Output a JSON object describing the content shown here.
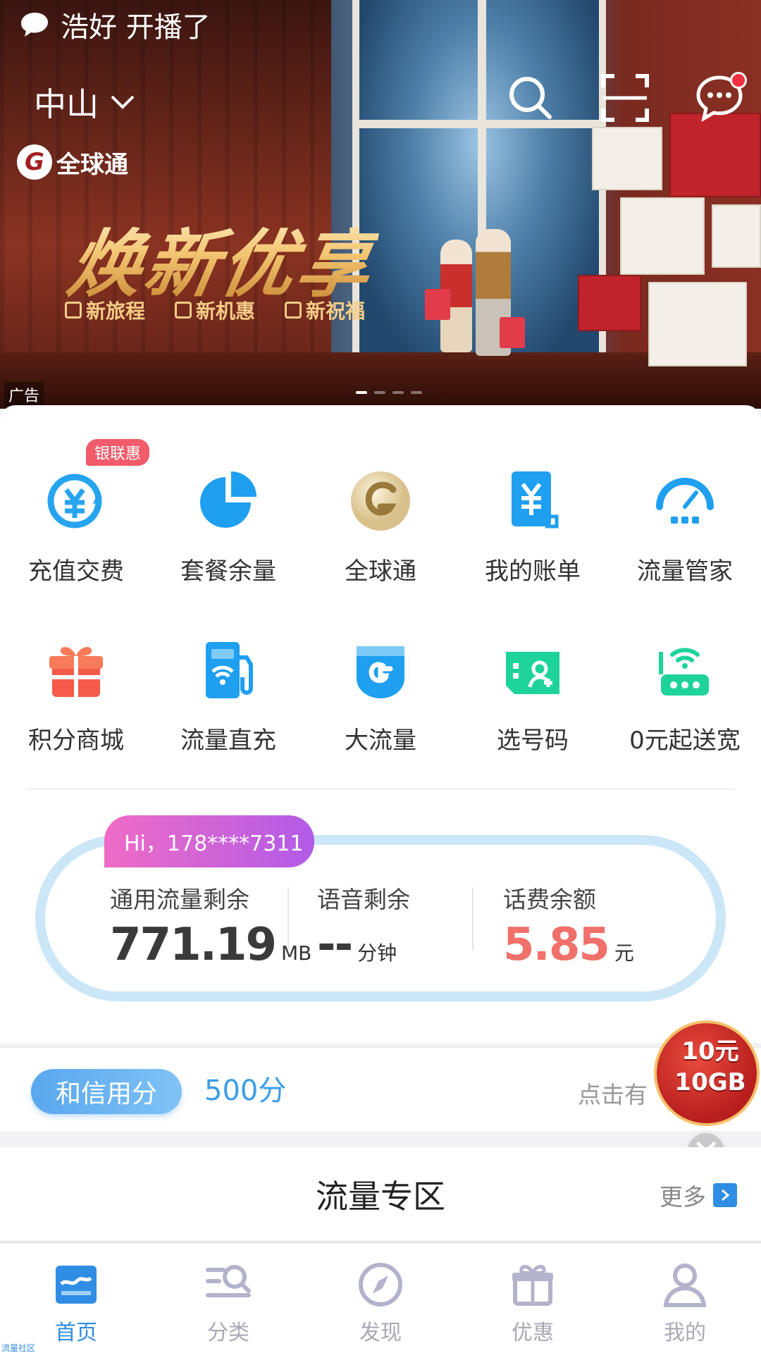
{
  "notification": {
    "text": "浩好 开播了"
  },
  "header": {
    "city": "中山"
  },
  "banner": {
    "brand": "全球通",
    "title": "焕新优享",
    "tags": [
      "新旅程",
      "新机惠",
      "新祝福"
    ],
    "ad_label": "广告"
  },
  "services": [
    {
      "label": "充值交费",
      "icon": "recharge-icon",
      "badge": "银联惠"
    },
    {
      "label": "套餐余量",
      "icon": "pie-chart-icon"
    },
    {
      "label": "全球通",
      "icon": "global-pass-icon"
    },
    {
      "label": "我的账单",
      "icon": "bill-icon"
    },
    {
      "label": "流量管家",
      "icon": "speedometer-icon"
    },
    {
      "label": "积分商城",
      "icon": "gift-icon"
    },
    {
      "label": "流量直充",
      "icon": "fuel-pump-icon"
    },
    {
      "label": "大流量",
      "icon": "big-data-icon"
    },
    {
      "label": "选号码",
      "icon": "sim-card-icon"
    },
    {
      "label": "0元起送宽",
      "icon": "router-icon"
    }
  ],
  "account": {
    "greeting": "Hi，178****7311",
    "data_label": "通用流量剩余",
    "data_value": "771.19",
    "data_unit": "MB",
    "voice_label": "语音剩余",
    "voice_value": "--",
    "voice_unit": "分钟",
    "balance_label": "话费余额",
    "balance_value": "5.85",
    "balance_unit": "元"
  },
  "credit": {
    "label": "和信用分",
    "score": "500分",
    "link": "点击有"
  },
  "promo": {
    "line1": "10元",
    "line2": "10GB"
  },
  "zone": {
    "title": "流量专区",
    "more": "更多"
  },
  "tabs": [
    {
      "label": "首页",
      "icon": "home-icon",
      "active": true
    },
    {
      "label": "分类",
      "icon": "category-icon"
    },
    {
      "label": "发现",
      "icon": "compass-icon"
    },
    {
      "label": "优惠",
      "icon": "gift-box-icon"
    },
    {
      "label": "我的",
      "icon": "user-icon"
    }
  ],
  "footer_note": "流量社区",
  "colors": {
    "accent": "#2f8de4",
    "balance_red": "#f0706a",
    "badge": "#f15b6a"
  }
}
